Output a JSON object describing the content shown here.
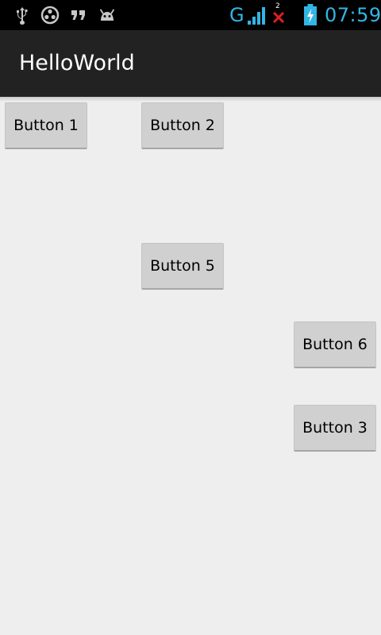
{
  "status_bar": {
    "icons_left": [
      "usb-icon",
      "settings-circle-icon",
      "quote-icon",
      "android-icon"
    ],
    "network_type": "G",
    "signal_icon": "signal-bars-icon",
    "sim_badge": "2",
    "no_data_icon": "red-x-icon",
    "battery_icon": "battery-charging-icon",
    "time": "07:59",
    "accent_color": "#33b5e5"
  },
  "app": {
    "title": "HelloWorld"
  },
  "buttons": {
    "b1": "Button 1",
    "b2": "Button 2",
    "b5": "Button 5",
    "b6": "Button 6",
    "b3": "Button 3"
  }
}
